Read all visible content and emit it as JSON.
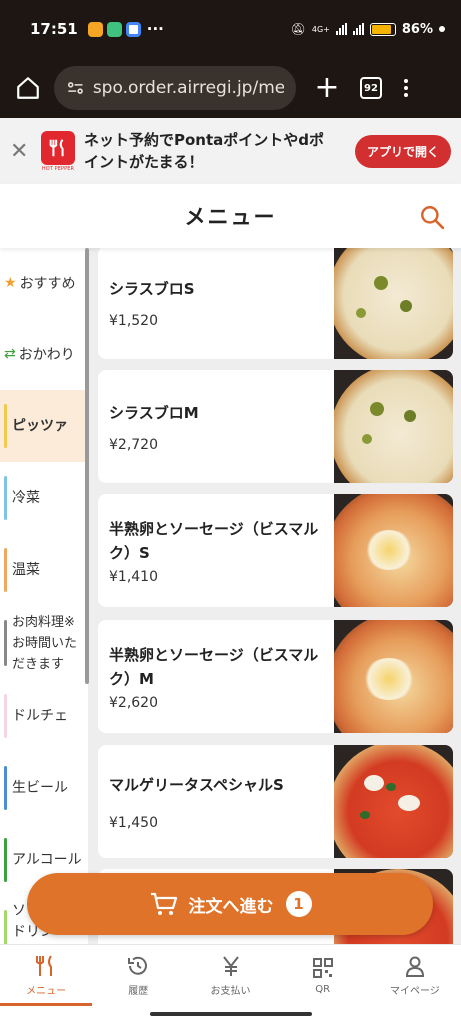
{
  "status_bar": {
    "time": "17:51",
    "more": "···",
    "battery_percent": "86%",
    "battery_level": 0.86,
    "network_label": "4G+"
  },
  "browser": {
    "url": "spo.order.airregi.jp/men",
    "tab_count": "92"
  },
  "promo": {
    "brand_text": "HOT PEPPER",
    "message": "ネット予約でPontaポイントやdポイントがたまる！",
    "button_label": "アプリで開く"
  },
  "header": {
    "title": "メニュー"
  },
  "categories": [
    {
      "label": "おすすめ",
      "icon": "star-icon"
    },
    {
      "label": "おかわり",
      "icon": "repeat-icon"
    },
    {
      "label": "ピッツァ",
      "active": true
    },
    {
      "label": "冷菜"
    },
    {
      "label": "温菜"
    },
    {
      "label": "お肉料理※お時間いただきます"
    },
    {
      "label": "ドルチェ"
    },
    {
      "label": "生ビール"
    },
    {
      "label": "アルコール"
    },
    {
      "label": "ソフトドリンク"
    }
  ],
  "items": [
    {
      "name": "シラスブロS",
      "price": "¥1,520"
    },
    {
      "name": "シラスブロM",
      "price": "¥2,720"
    },
    {
      "name": "半熟卵とソーセージ（ビスマルク）S",
      "price": "¥1,410"
    },
    {
      "name": "半熟卵とソーセージ（ビスマルク）M",
      "price": "¥2,620"
    },
    {
      "name": "マルゲリータスペシャルS",
      "price": "¥1,450"
    }
  ],
  "order_button": {
    "label": "注文へ進む",
    "count": "1"
  },
  "bottom_nav": [
    {
      "label": "メニュー",
      "icon": "fork-knife-icon",
      "active": true
    },
    {
      "label": "履歴",
      "icon": "history-icon"
    },
    {
      "label": "お支払い",
      "icon": "yen-icon"
    },
    {
      "label": "QR",
      "icon": "qr-code-icon"
    },
    {
      "label": "マイページ",
      "icon": "person-icon"
    }
  ],
  "colors": {
    "accent": "#e0732a",
    "active_category_bg": "#fdebd9",
    "promo_button": "#d22f30"
  }
}
